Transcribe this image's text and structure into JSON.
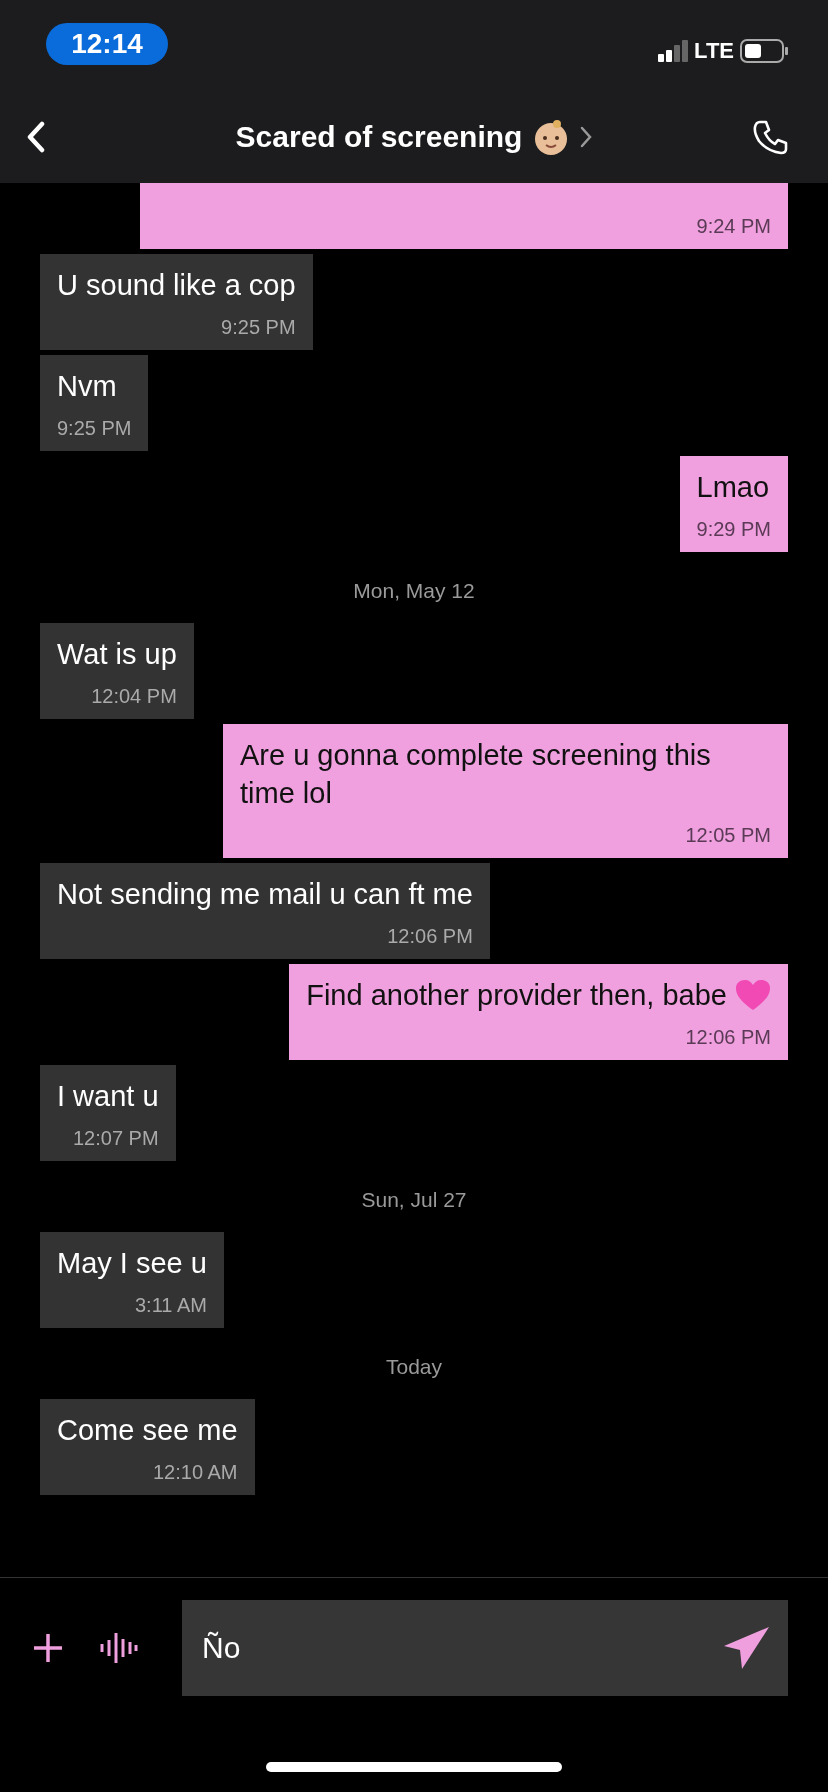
{
  "status_bar": {
    "time": "12:14",
    "network": "LTE"
  },
  "header": {
    "title": "Scared of screening"
  },
  "messages": [
    {
      "kind": "outgoing",
      "time": "9:24 PM",
      "partial": true
    },
    {
      "kind": "incoming",
      "text": "U sound like a cop",
      "time": "9:25 PM"
    },
    {
      "kind": "incoming",
      "text": "Nvm",
      "time": "9:25 PM"
    },
    {
      "kind": "outgoing",
      "text": "Lmao",
      "time": "9:29 PM"
    },
    {
      "kind": "date",
      "text": "Mon, May 12"
    },
    {
      "kind": "incoming",
      "text": "Wat is up",
      "time": "12:04 PM"
    },
    {
      "kind": "outgoing",
      "text": "Are u gonna complete screening this time lol",
      "time": "12:05 PM"
    },
    {
      "kind": "incoming",
      "text": "Not sending me mail u can ft me",
      "time": "12:06 PM"
    },
    {
      "kind": "outgoing",
      "text": "Find another provider then, babe",
      "time": "12:06 PM",
      "heart": true
    },
    {
      "kind": "incoming",
      "text": "I want u",
      "time": "12:07 PM"
    },
    {
      "kind": "date",
      "text": "Sun, Jul 27"
    },
    {
      "kind": "incoming",
      "text": "May I see u",
      "time": "3:11 AM"
    },
    {
      "kind": "date",
      "text": "Today"
    },
    {
      "kind": "incoming",
      "text": "Come see me",
      "time": "12:10 AM"
    }
  ],
  "composer": {
    "value": "Ño"
  }
}
